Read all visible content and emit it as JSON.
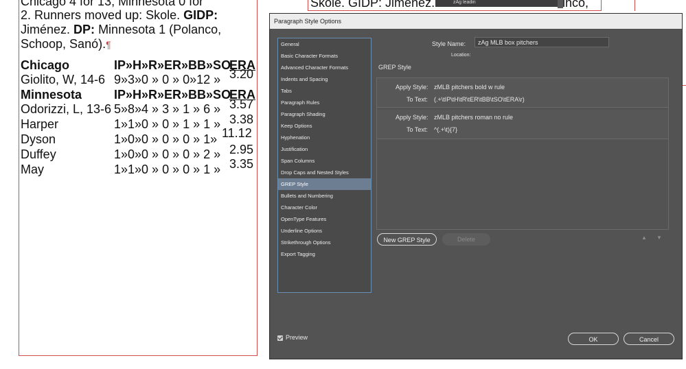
{
  "document": {
    "partial_top": "Chicago 4 for 13, Minnesota 0 for",
    "line2": "2. Runners moved up: Skole.",
    "gidp_label": "GIDP:",
    "line3_rest": "Jiménez.",
    "dp_label": "DP:",
    "line3_end": "Minnesota 1 (Polanco,",
    "line4": "Schoop, Sanó).",
    "pilcrow": "¶",
    "tab_mark": "»",
    "header_chicago": {
      "name": "Chicago",
      "stats": "IP»H»R»ER»BB»SO",
      "era": "ERA"
    },
    "header_minnesota": {
      "name": "Minnesota",
      "stats": "IP»H»R»ER»BB»SO",
      "era": "ERA"
    },
    "rows": [
      {
        "name": "Giolito, W, 14-6",
        "stats": "9»3»0 » 0 » 0»12 »",
        "era": "3.20"
      },
      {
        "name": "Odorizzi, L, 13-6",
        "stats": "5»8»4 » 3 » 1 » 6 »",
        "era": "3.57"
      },
      {
        "name": "Harper",
        "stats": "1»1»0 » 0 » 1 » 1 »",
        "era": "3.38"
      },
      {
        "name": "Dyson",
        "stats": "1»0»0 » 0 » 0 » 1»",
        "era": "11.12"
      },
      {
        "name": "Duffey",
        "stats": "1»0»0 » 0 » 0 » 2 »",
        "era": "2.95"
      },
      {
        "name": "May",
        "stats": "1»1»0 » 0 » 0 » 1 »",
        "era": "3.35"
      }
    ],
    "bg_right_text": "Skole. GIDP: Jiménez.",
    "bg_right_text2": "nco,",
    "menu_item": "zAg leadin"
  },
  "dialog": {
    "title": "Paragraph Style Options",
    "style_name_label": "Style Name:",
    "style_name_value": "zAg MLB box pitchers",
    "location_label": "Location:",
    "section_title": "GREP Style",
    "sidebar": [
      "General",
      "Basic Character Formats",
      "Advanced Character Formats",
      "Indents and Spacing",
      "Tabs",
      "Paragraph Rules",
      "Paragraph Shading",
      "Keep Options",
      "Hyphenation",
      "Justification",
      "Span Columns",
      "Drop Caps and Nested Styles",
      "GREP Style",
      "Bullets and Numbering",
      "Character Color",
      "OpenType Features",
      "Underline Options",
      "Strikethrough Options",
      "Export Tagging"
    ],
    "selected_index": 12,
    "grep_rules": [
      {
        "apply_label": "Apply Style:",
        "apply_value": "zMLB pitchers bold w rule",
        "text_label": "To Text:",
        "text_value": "(.+\\tIP\\tH\\tR\\tER\\tBB\\tSO\\tERA\\r)"
      },
      {
        "apply_label": "Apply Style:",
        "apply_value": "zMLB pitchers roman no rule",
        "text_label": "To Text:",
        "text_value": "^(.+\\t){7}"
      }
    ],
    "new_grep_button": "New GREP Style",
    "delete_button": "Delete",
    "up_arrow": "▲",
    "down_arrow": "▼",
    "preview_label": "Preview",
    "ok_button": "OK",
    "cancel_button": "Cancel"
  }
}
